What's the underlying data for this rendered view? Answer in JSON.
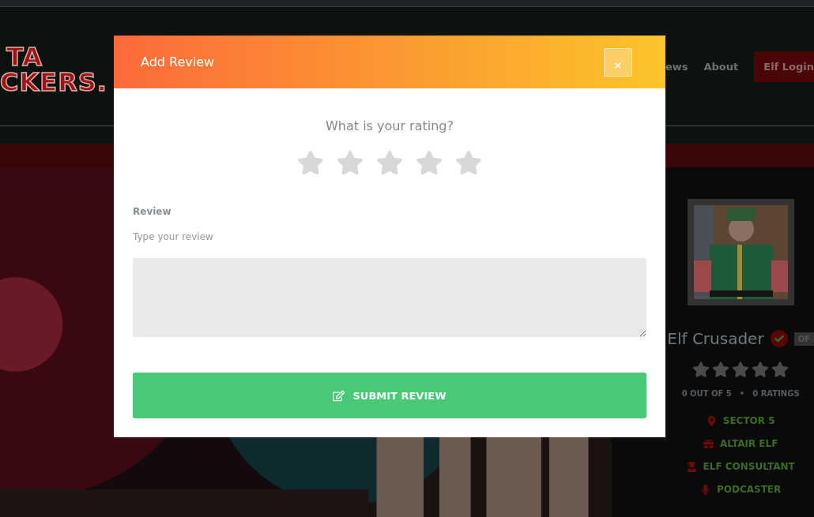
{
  "site": {
    "logo_lines": [
      "TA",
      "CKERS."
    ],
    "nav": [
      {
        "label": "ews",
        "kind": "link"
      },
      {
        "label": "About",
        "kind": "link"
      },
      {
        "label": "Elf Login",
        "kind": "button"
      }
    ]
  },
  "profile": {
    "name": "Elf Crusader",
    "verified": true,
    "badge": "OF",
    "stars": 0,
    "score": "0 OUT OF 5",
    "separator": "•",
    "ratings": "0 RATINGS",
    "details": [
      {
        "label": "SECTOR 5",
        "kind": "location"
      },
      {
        "label": "ALTAIR ELF",
        "kind": "gift"
      },
      {
        "label": "ELF CONSULTANT",
        "kind": "graduate"
      },
      {
        "label": "PODCASTER",
        "kind": "microphone"
      }
    ]
  },
  "modal": {
    "title": "Add Review",
    "close": "×",
    "question": "What is your rating?",
    "stars": 0,
    "review_label": "Review",
    "review_hint": "Type your review",
    "submit": "SUBMIT REVIEW"
  }
}
